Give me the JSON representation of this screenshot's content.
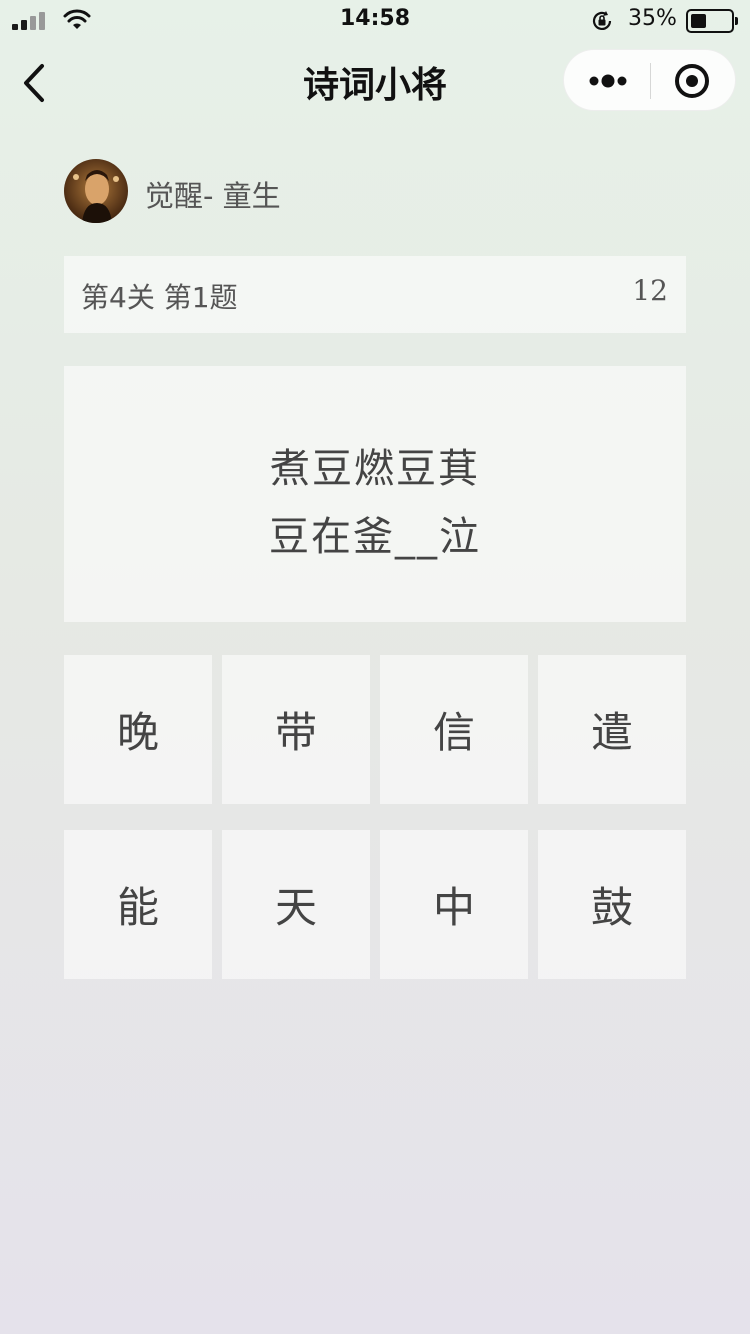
{
  "status_bar": {
    "time": "14:58",
    "battery": "35%",
    "battery_level": 0.35
  },
  "nav": {
    "title": "诗词小将"
  },
  "user": {
    "name": "觉醒- 童生"
  },
  "level": {
    "label": "第4关 第1题",
    "timer": "12"
  },
  "question": {
    "lines": [
      "煮豆燃豆萁",
      "豆在釜__泣"
    ]
  },
  "options": [
    "晚",
    "带",
    "信",
    "遣",
    "能",
    "天",
    "中",
    "鼓"
  ]
}
